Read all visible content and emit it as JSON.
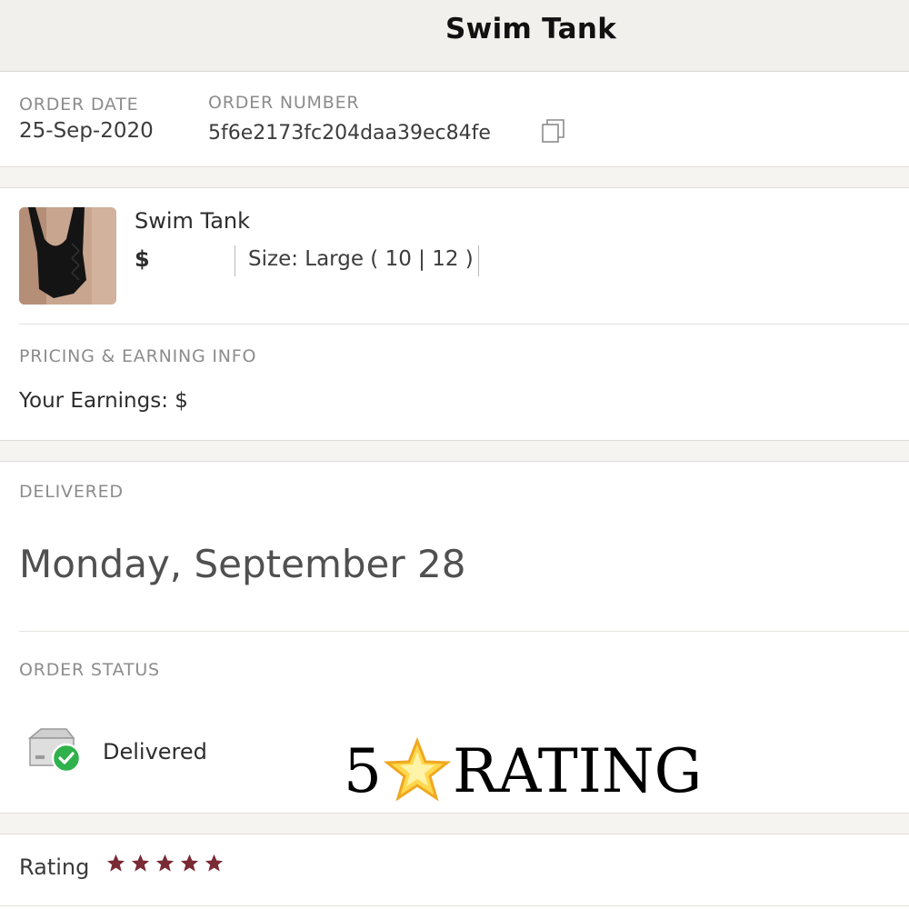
{
  "header": {
    "title": "Swim Tank"
  },
  "order": {
    "date_label": "ORDER DATE",
    "date_value": "25-Sep-2020",
    "number_label": "ORDER NUMBER",
    "number_value": "5f6e2173fc204daa39ec84fe"
  },
  "item": {
    "title": "Swim Tank",
    "price": "$",
    "size": "Size: Large ( 10 | 12 )"
  },
  "pricing": {
    "label": "PRICING & EARNING INFO",
    "earnings": "Your Earnings: $"
  },
  "delivery": {
    "label": "DELIVERED",
    "date": "Monday, September 28"
  },
  "status": {
    "label": "ORDER STATUS",
    "value": "Delivered"
  },
  "overlay": {
    "left": "5",
    "right": "RATING"
  },
  "rating": {
    "label": "Rating",
    "stars": 5,
    "star_color": "#7a2a35"
  },
  "colors": {
    "header_bg": "#f1f0ec",
    "check_green": "#2fb14b"
  }
}
